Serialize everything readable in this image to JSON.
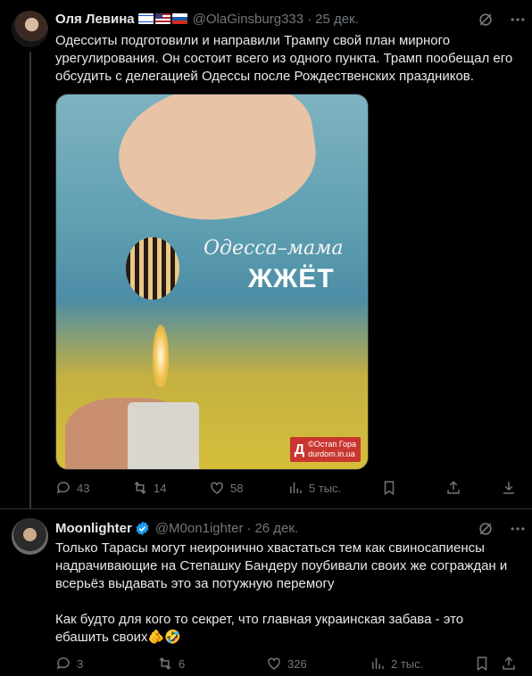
{
  "tweets": [
    {
      "author": {
        "name": "Оля Левина",
        "handle": "@OlaGinsburg333",
        "flags": [
          "flag-israel",
          "flag-usa",
          "flag-russia"
        ],
        "verified": false
      },
      "separator": "·",
      "date": "25 дек.",
      "text": "Одесситы подготовили и направили Трампу свой план мирного урегулирования. Он состоит всего из одного пункта. Трамп пообещал его обсудить с делегацией Одессы после Рождественских праздников.",
      "media": {
        "caption_line1": "Одесса–мама",
        "caption_line2": "ЖЖЁТ",
        "watermark_letter": "Д",
        "watermark_line1": "©Остап Гора",
        "watermark_line2": "durdom.in.ua"
      },
      "stats": {
        "replies": "43",
        "reposts": "14",
        "likes": "58",
        "views": "5 тыс."
      }
    },
    {
      "author": {
        "name": "Moonlighter",
        "handle": "@M0on1ighter",
        "verified": true
      },
      "separator": "·",
      "date": "26 дек.",
      "text_p1": "Только Тарасы могут неиронично хвастаться тем как свиносапиенсы надрачивающие на Степашку Бандеру поубивали своих же сограждан и всерьёз выдавать это за потужную перемогу",
      "text_p2": "Как будто для кого то секрет, что главная украинская забава - это ебашить своих🫵🤣",
      "stats": {
        "replies": "3",
        "reposts": "6",
        "likes": "326",
        "views": "2 тыс."
      }
    }
  ],
  "colors": {
    "background": "#000000",
    "text": "#e7e9ea",
    "muted": "#71767b",
    "verified": "#1d9bf0",
    "divider": "#2f3336"
  },
  "icons": [
    "grok-icon",
    "more-icon",
    "reply-icon",
    "repost-icon",
    "like-icon",
    "views-icon",
    "bookmark-icon",
    "share-icon",
    "download-icon",
    "verified-badge-icon"
  ]
}
